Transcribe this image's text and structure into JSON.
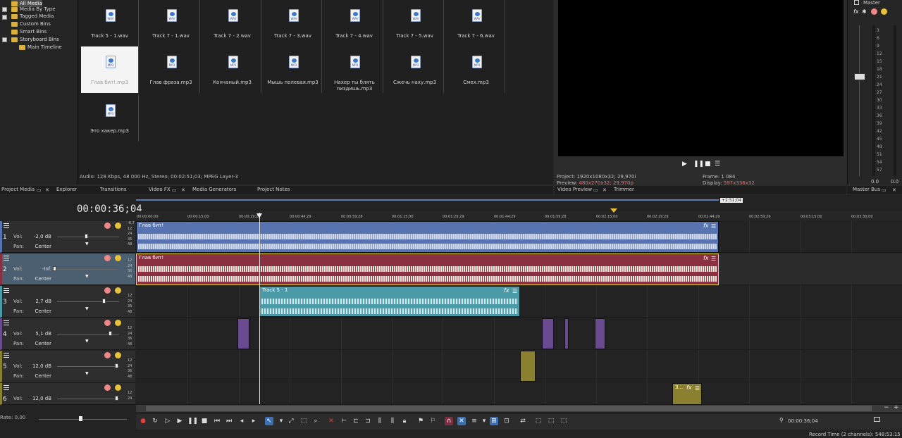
{
  "tree": {
    "items": [
      "All Media",
      "Media By Type",
      "Tagged Media",
      "Custom Bins",
      "Smart Bins",
      "Storyboard Bins",
      "Main Timeline"
    ]
  },
  "media": {
    "row1": [
      "Track 5 - 1.wav",
      "Track 7 - 1.wav",
      "Track 7 - 2.wav",
      "Track 7 - 3.wav",
      "Track 7 - 4.wav",
      "Track 7 - 5.wav",
      "Track 7 - 6.wav"
    ],
    "row2": [
      "Глав бит!.mp3",
      "Глав фраза.mp3",
      "Кончаный.mp3",
      "Мышь полевая.mp3",
      "Нахер ты блять пиздишь.mp3",
      "Сжечь наху.mp3",
      "Смех.mp3"
    ],
    "row3": [
      "Это хакер.mp3"
    ],
    "ext_wav": "WAV",
    "ext_mp3": "MP3",
    "status": "Audio: 128 Kbps, 48 000 Hz, Stereo; 00:02:51;03; MPEG Layer-3"
  },
  "preview": {
    "project_label": "Project:",
    "project_value": "1920x1080x32; 29,970i",
    "preview_label": "Preview:",
    "preview_value": "480x270x32; 29,970p",
    "frame_label": "Frame:",
    "frame_value": "1 084",
    "display_label": "Display:",
    "display_value": "597x336x32"
  },
  "master": {
    "title": "Master",
    "ticks": [
      "3",
      "6",
      "9",
      "12",
      "15",
      "18",
      "21",
      "24",
      "27",
      "30",
      "33",
      "36",
      "39",
      "42",
      "45",
      "48",
      "51",
      "54",
      "57"
    ],
    "left_value": "0.0",
    "right_value": "0.0"
  },
  "tabs": {
    "project_media": "Project Media",
    "explorer": "Explorer",
    "transitions": "Transitions",
    "video_fx": "Video FX",
    "media_generators": "Media Generators",
    "project_notes": "Project Notes",
    "video_preview": "Video Preview",
    "trimmer": "Trimmer",
    "master_bus": "Master Bus"
  },
  "timeline": {
    "timecode": "00:00:36;04",
    "ruler": [
      "00:00:00;00",
      "00:00:15;00",
      "00:00:29;29",
      "00:00:44;29",
      "00:00:59;28",
      "00:01:15;00",
      "00:01:29;29",
      "00:01:44;29",
      "00:01:59;28",
      "00:02:15;00",
      "00:02:29;29",
      "00:02:44;29",
      "00:02:59;29",
      "00:03:15;00",
      "00:03:30;00"
    ],
    "end_marker": "+2:51;04",
    "scale_top": "-6,7",
    "scale": [
      "12",
      "24",
      "36",
      "48"
    ],
    "vol_label": "Vol:",
    "pan_label": "Pan:",
    "tracks": [
      {
        "num": "1",
        "vol": "-2,0 dB",
        "pan": "Center"
      },
      {
        "num": "2",
        "vol": "-Inf.",
        "pan": "Center"
      },
      {
        "num": "3",
        "vol": "2,7 dB",
        "pan": "Center"
      },
      {
        "num": "4",
        "vol": "5,1 dB",
        "pan": "Center"
      },
      {
        "num": "5",
        "vol": "12,0 dB",
        "pan": "Center"
      },
      {
        "num": "6",
        "vol": "12,0 dB",
        "pan": "Center"
      }
    ],
    "clips": {
      "c1": "Глав бит!",
      "c2": "Глав бит!",
      "c3": "Track 5 - 1",
      "c6": "З..."
    },
    "fx": "fx"
  },
  "bottom": {
    "rate": "Rate: 0,00",
    "cursor_time": "00:00:36;04",
    "record_time": "Record Time (2 channels): 548:53:15"
  },
  "colors": {
    "track1": "#5874b0",
    "track2": "#8a3040",
    "track3": "#4a9aa8",
    "track4": "#6a4a90",
    "track5": "#8a8030"
  }
}
